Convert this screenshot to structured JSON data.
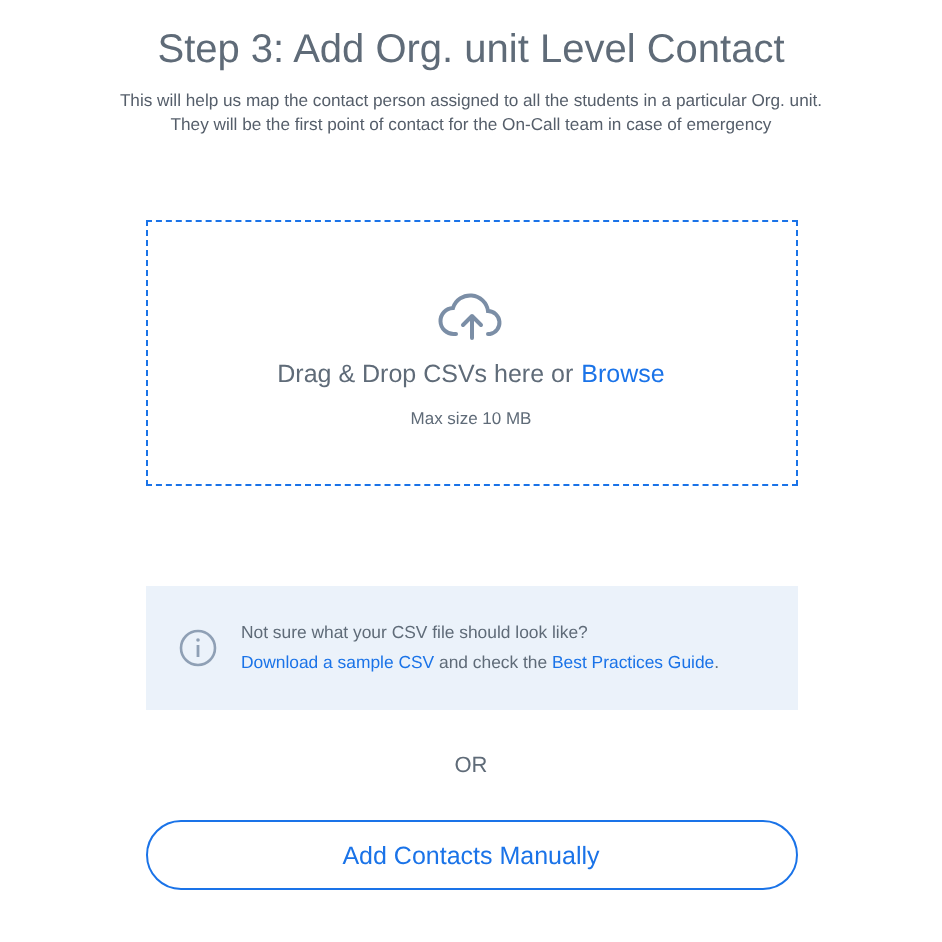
{
  "title": "Step 3: Add Org. unit Level Contact",
  "description": [
    "This will help us map the contact person assigned to all the students in a particular Org. unit.",
    "They will be the first point of contact for the On-Call team in case of emergency"
  ],
  "dropzone": {
    "prompt": "Drag & Drop CSVs here or",
    "link": "Browse",
    "note": "Max size 10 MB"
  },
  "info": [
    {
      "text": "Not sure what your CSV file should look like? ",
      "link": false
    },
    {
      "text": "Download a sample CSV",
      "link": true
    },
    {
      "text": " and check the ",
      "link": false
    },
    {
      "text": "Best Practices Guide",
      "link": true
    },
    {
      "text": ".",
      "link": false
    }
  ],
  "separator": "OR",
  "button": "Add Contacts Manually"
}
